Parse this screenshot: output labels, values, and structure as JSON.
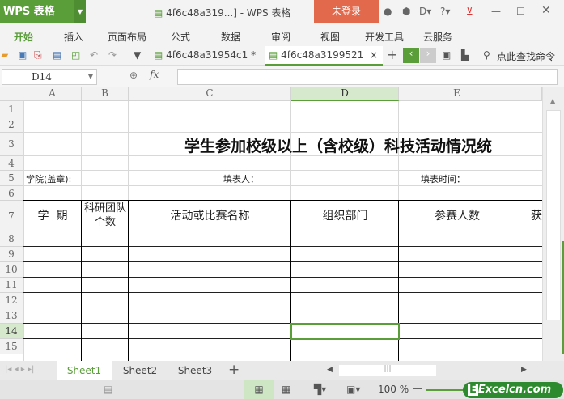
{
  "app": {
    "logo": "WPS 表格",
    "window_title": "4f6c48a319...] - WPS 表格",
    "login": "未登录",
    "help": "?"
  },
  "menu": [
    "开始",
    "插入",
    "页面布局",
    "公式",
    "数据",
    "审阅",
    "视图",
    "开发工具",
    "云服务"
  ],
  "doc_tabs": [
    {
      "label": "4f6c48a31954c1 *"
    },
    {
      "label": "4f6c48a3199521"
    }
  ],
  "search_label": "点此查找命令",
  "formula_bar": {
    "cell_ref": "D14",
    "fx": "fx",
    "value": ""
  },
  "columns": [
    "A",
    "B",
    "C",
    "D",
    "E"
  ],
  "rows": [
    "1",
    "2",
    "3",
    "4",
    "5",
    "6",
    "7",
    "8",
    "9",
    "10",
    "11",
    "12",
    "13",
    "14",
    "15"
  ],
  "selected_cell": "D14",
  "sheet": {
    "title": "学生参加校级以上（含校级）科技活动情况统",
    "college": "学院(盖章):",
    "filler": "填表人：",
    "fill_time": "填表时间：",
    "headers": [
      "学  期",
      "科研团队个数",
      "活动或比赛名称",
      "组织部门",
      "参赛人数",
      "获"
    ]
  },
  "sheet_tabs": [
    "Sheet1",
    "Sheet2",
    "Sheet3"
  ],
  "active_sheet": "Sheet1",
  "zoom": "100 %",
  "watermark": "Excelcn.com",
  "colors": {
    "accent": "#5a9e3a",
    "login": "#e2694c"
  }
}
